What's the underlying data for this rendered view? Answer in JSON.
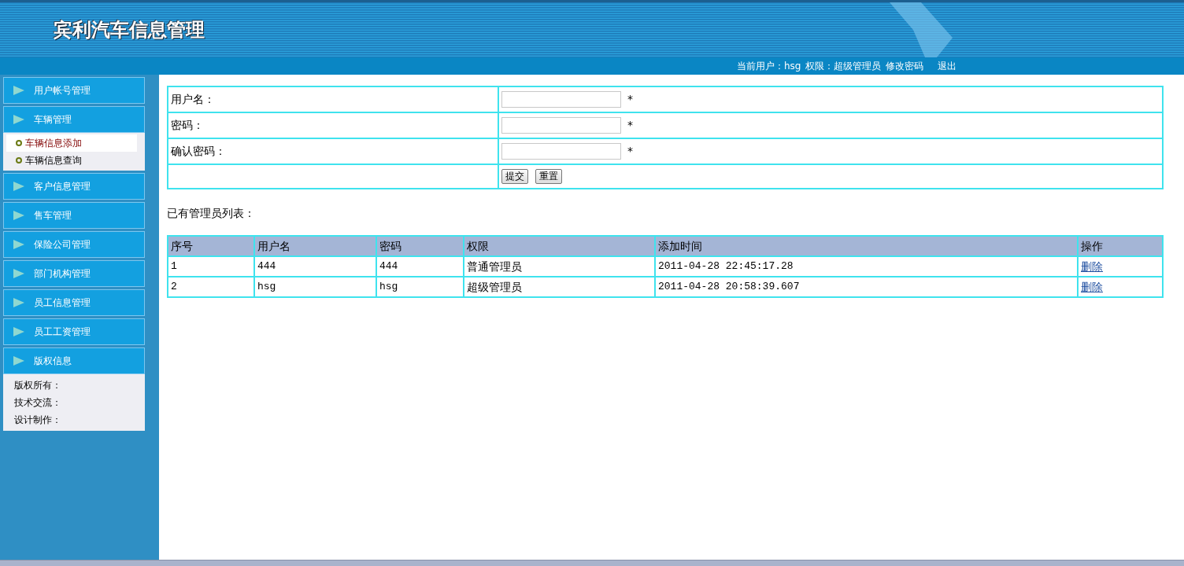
{
  "header": {
    "title": "宾利汽车信息管理"
  },
  "user_bar": {
    "user_label": "当前用户：",
    "username": "hsg",
    "role_label": "权限：",
    "role": "超级管理员",
    "change_password": "修改密码",
    "logout": "退出"
  },
  "sidebar": {
    "menu": [
      {
        "label": "用户帐号管理"
      },
      {
        "label": "车辆管理",
        "children": [
          {
            "label": "车辆信息添加",
            "selected": true
          },
          {
            "label": "车辆信息查询",
            "selected": false
          }
        ]
      },
      {
        "label": "客户信息管理"
      },
      {
        "label": "售车管理"
      },
      {
        "label": "保险公司管理"
      },
      {
        "label": "部门机构管理"
      },
      {
        "label": "员工信息管理"
      },
      {
        "label": "员工工资管理"
      },
      {
        "label": "版权信息",
        "lines": [
          "版权所有：",
          "技术交流：",
          "设计制作："
        ]
      }
    ]
  },
  "form": {
    "fields": [
      {
        "label": "用户名：",
        "required_mark": "*"
      },
      {
        "label": "密码：",
        "required_mark": "*"
      },
      {
        "label": "确认密码：",
        "required_mark": "*"
      }
    ],
    "buttons": [
      "提交",
      "重置"
    ]
  },
  "list_title": "已有管理员列表：",
  "table": {
    "columns": [
      "序号",
      "用户名",
      "密码",
      "权限",
      "添加时间",
      "操作"
    ],
    "rows": [
      {
        "cells": [
          "1",
          "444",
          "444",
          "普通管理员",
          "2011-04-28 22:45:17.28"
        ],
        "action": "删除"
      },
      {
        "cells": [
          "2",
          "hsg",
          "hsg",
          "超级管理员",
          "2011-04-28 20:58:39.607"
        ],
        "action": "删除"
      }
    ]
  }
}
